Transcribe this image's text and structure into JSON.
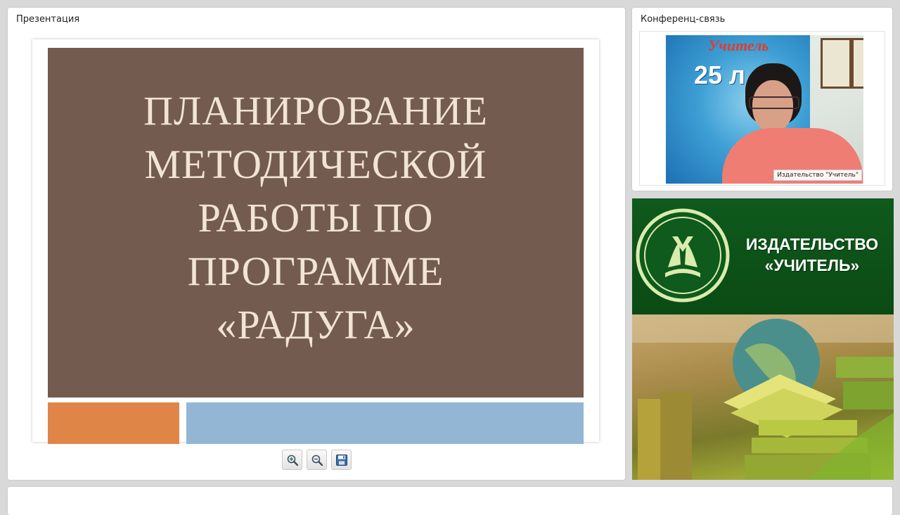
{
  "presentation": {
    "title": "Презентация",
    "slide": {
      "title_lines": [
        "ПЛАНИРОВАНИЕ",
        "МЕТОДИЧЕСКОЙ",
        "РАБОТЫ ПО",
        "ПРОГРАММЕ",
        "«РАДУГА»"
      ],
      "background_color": "#735b50",
      "text_color": "#f2e4d3",
      "accent_orange": "#e08548",
      "accent_blue": "#93b6d4"
    },
    "toolbar": {
      "zoom_in_icon": "zoom-in-icon",
      "zoom_out_icon": "zoom-out-icon",
      "save_icon": "floppy-disk-icon"
    }
  },
  "conference": {
    "title": "Конференц-связь",
    "video": {
      "participant_label": "Издательство \"Учитель\"",
      "poster_brand": "Учитель",
      "poster_number": "25 л"
    }
  },
  "banner": {
    "line1": "ИЗДАТЕЛЬСТВО",
    "line2": "«УЧИТЕЛЬ»",
    "background_color": "#0f5a1d"
  }
}
